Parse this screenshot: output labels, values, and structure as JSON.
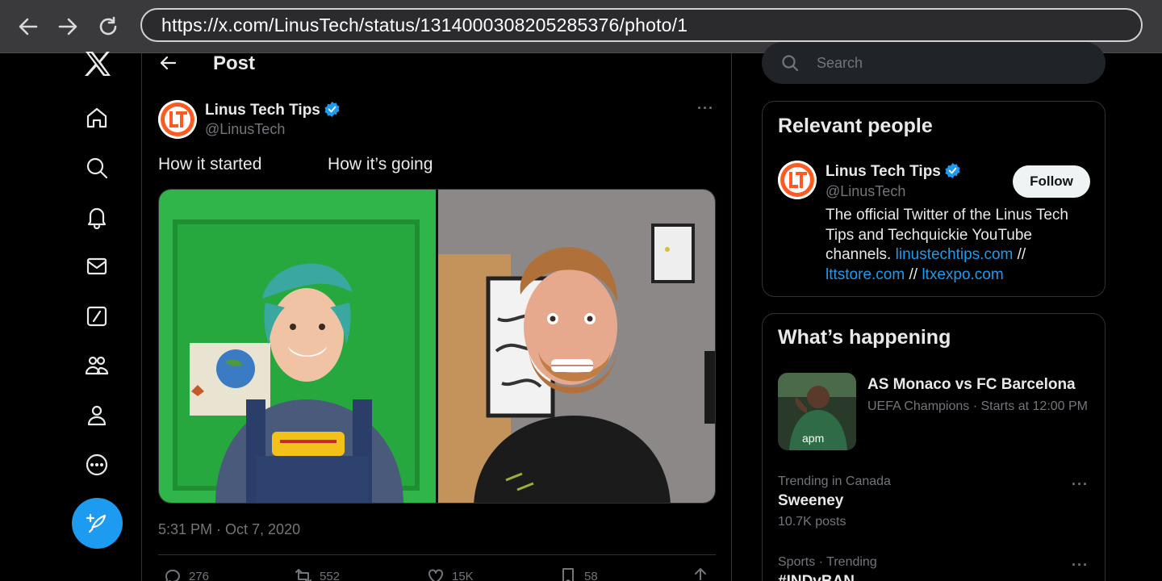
{
  "browser": {
    "url": "https://x.com/LinusTech/status/1314000308205285376/photo/1"
  },
  "header": {
    "title": "Post"
  },
  "tweet": {
    "author_name": "Linus Tech Tips",
    "author_handle": "@LinusTech",
    "text": "How it started              How it’s going",
    "timestamp": "5:31 PM · Oct 7, 2020",
    "more": "···",
    "stats": {
      "replies": "276",
      "reposts": "552",
      "likes": "15K",
      "bookmarks": "58"
    }
  },
  "search": {
    "placeholder": "Search"
  },
  "relevant_people": {
    "title": "Relevant people",
    "name": "Linus Tech Tips",
    "handle": "@LinusTech",
    "follow_label": "Follow",
    "bio_text": "The official Twitter of the Linus Tech Tips and Techquickie YouTube channels.",
    "link1": "linustechtips.com",
    "sep1": " // ",
    "link2": "lttstore.com",
    "sep2": " // ",
    "link3": "ltxexpo.com"
  },
  "whats_happening": {
    "title": "What’s happening",
    "event_title": "AS Monaco vs FC Barcelona",
    "event_meta": "UEFA Champions · Starts at 12:00 PM",
    "trend1_context": "Trending in Canada",
    "trend1_title": "Sweeney",
    "trend1_posts": "10.7K posts",
    "trend2_context": "Sports · Trending",
    "trend2_title": "#INDvBAN",
    "more": "···"
  },
  "colors": {
    "accent": "#1d9bf0",
    "background": "#000000",
    "border": "#2f3336",
    "muted_text": "#71767b"
  },
  "icons": [
    "back-icon",
    "forward-icon",
    "reload-icon",
    "x-logo-icon",
    "home-icon",
    "search-icon",
    "bell-icon",
    "mail-icon",
    "grok-icon",
    "communities-icon",
    "profile-icon",
    "more-circle-icon",
    "compose-icon",
    "verified-icon",
    "reply-icon",
    "repost-icon",
    "like-icon",
    "bookmark-icon",
    "share-icon"
  ]
}
